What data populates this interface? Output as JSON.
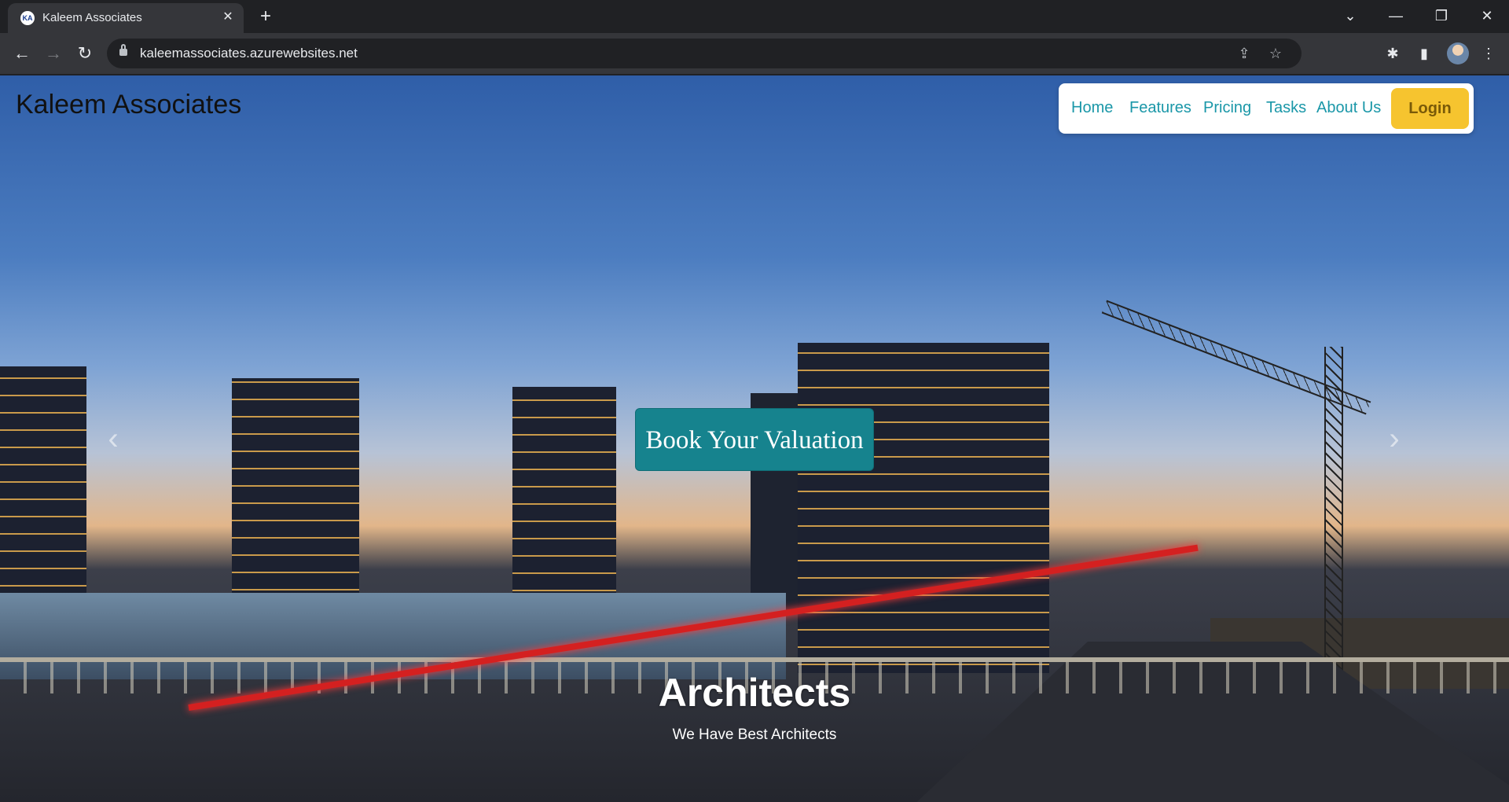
{
  "browser": {
    "tab_title": "Kaleem Associates",
    "tab_favicon_text": "KA",
    "url": "kaleemassociates.azurewebsites.net",
    "icons": {
      "back": "back-arrow-icon",
      "forward": "forward-arrow-icon",
      "reload": "reload-icon",
      "share": "share-icon",
      "bookmark": "star-icon",
      "extensions": "puzzle-icon",
      "side_panel": "side-panel-icon",
      "menu": "kebab-menu-icon"
    }
  },
  "site": {
    "brand": "Kaleem Associates",
    "nav": [
      {
        "label": "Home"
      },
      {
        "label": "Features"
      },
      {
        "label": "Pricing"
      },
      {
        "label": "Tasks"
      },
      {
        "label": "About Us"
      }
    ],
    "login_label": "Login",
    "cta_label": "Book Your Valuation",
    "caption_title": "Architects",
    "caption_subtitle": "We Have Best Architects"
  },
  "colors": {
    "nav_link": "#1a97a8",
    "login_bg": "#f6c42f",
    "cta_bg": "#16838e"
  }
}
